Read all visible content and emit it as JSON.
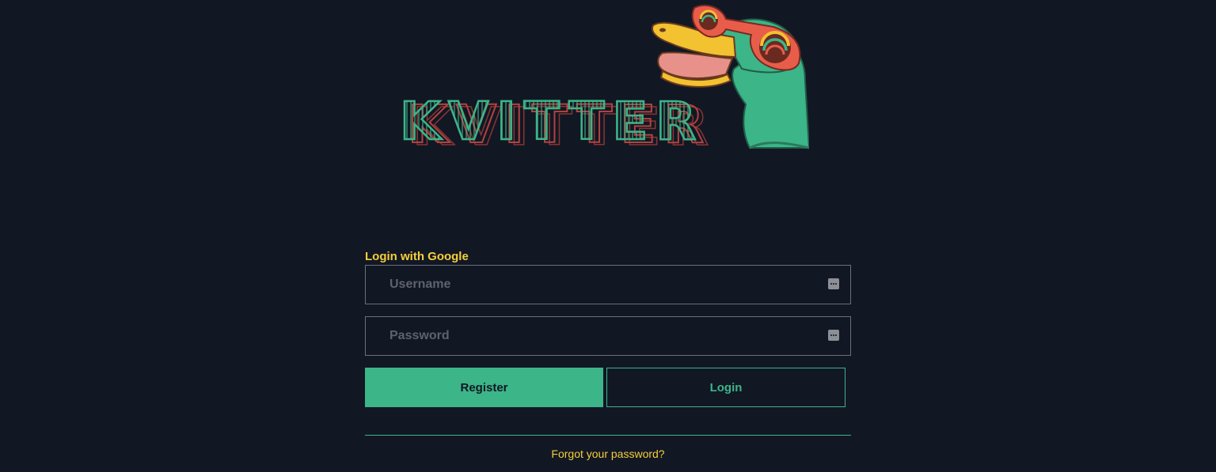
{
  "logo": {
    "wordmark": "KVITTER"
  },
  "auth": {
    "google_login_label": "Login with Google",
    "username_placeholder": "Username",
    "password_placeholder": "Password",
    "register_label": "Register",
    "login_label": "Login",
    "forgot_password_label": "Forgot your password?"
  },
  "colors": {
    "background": "#121724",
    "accent_green": "#3cb588",
    "accent_yellow": "#f4cf3a",
    "logo_red": "#b2423e"
  },
  "icons": {
    "field_icon": "password-manager-key-icon"
  }
}
